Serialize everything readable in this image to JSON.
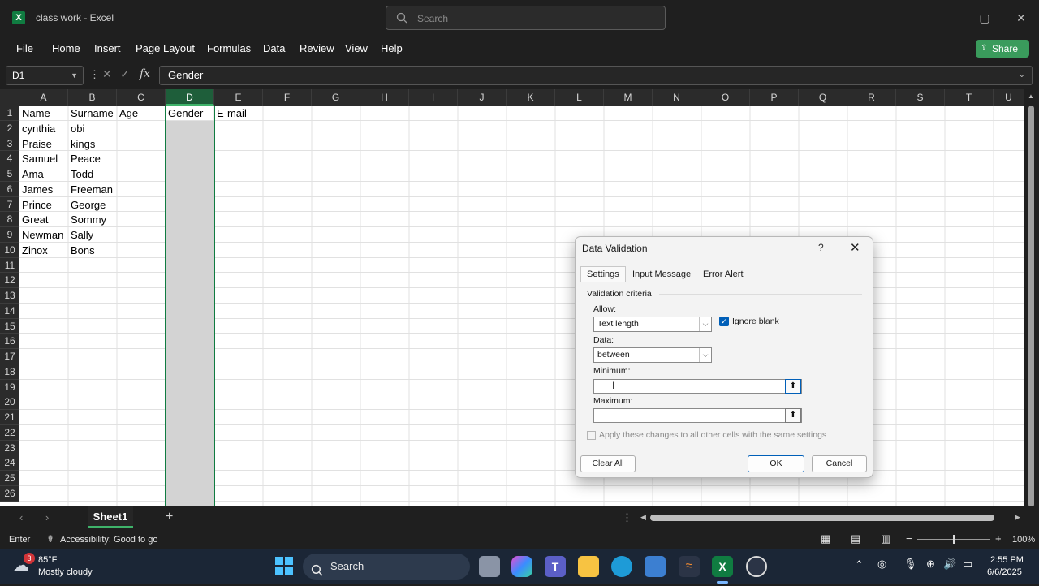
{
  "window": {
    "title": "class work - Excel",
    "search_placeholder": "Search",
    "minimize": "—",
    "maximize": "▢",
    "close": "✕"
  },
  "menu": [
    "File",
    "Home",
    "Insert",
    "Page Layout",
    "Formulas",
    "Data",
    "Review",
    "View",
    "Help"
  ],
  "share_label": "Share",
  "formula_bar": {
    "name_box": "D1",
    "fx": "fx",
    "value": "Gender"
  },
  "columns": [
    "A",
    "B",
    "C",
    "D",
    "E",
    "F",
    "G",
    "H",
    "I",
    "J",
    "K",
    "L",
    "M",
    "N",
    "O",
    "P",
    "Q",
    "R",
    "S",
    "T",
    "U"
  ],
  "rows": [
    "1",
    "2",
    "3",
    "4",
    "5",
    "6",
    "7",
    "8",
    "9",
    "10",
    "11",
    "12",
    "13",
    "14",
    "15",
    "16",
    "17",
    "18",
    "19",
    "20",
    "21",
    "22",
    "23",
    "24",
    "25",
    "26"
  ],
  "cells": {
    "A1": "Name",
    "B1": "Surname",
    "C1": "Age",
    "D1": "Gender",
    "E1": "E-mail",
    "A2": "cynthia",
    "B2": "obi",
    "A3": "Praise",
    "B3": "kings",
    "A4": "Samuel",
    "B4": "Peace",
    "A5": "Ama",
    "B5": "Todd",
    "A6": "James",
    "B6": "Freeman",
    "A7": "Prince",
    "B7": "George",
    "A8": "Great",
    "B8": "Sommy",
    "A9": "Newman",
    "B9": "Sally",
    "A10": "Zinox",
    "B10": "Bons"
  },
  "sheet_tab": "Sheet1",
  "status": {
    "mode": "Enter",
    "accessibility": "Accessibility: Good to go",
    "zoom": "100%"
  },
  "taskbar": {
    "weather_temp": "85°F",
    "weather_desc": "Mostly cloudy",
    "weather_badge": "3",
    "search_label": "Search",
    "time": "2:55 PM",
    "date": "6/6/2025"
  },
  "dialog": {
    "title": "Data Validation",
    "help": "?",
    "close": "✕",
    "tabs": [
      "Settings",
      "Input Message",
      "Error Alert"
    ],
    "section": "Validation criteria",
    "allow_label": "Allow:",
    "allow_value": "Text length",
    "ignore_blank_label": "Ignore blank",
    "ignore_blank_checked": true,
    "data_label": "Data:",
    "data_value": "between",
    "minimum_label": "Minimum:",
    "minimum_value": "",
    "maximum_label": "Maximum:",
    "maximum_value": "",
    "apply_label": "Apply these changes to all other cells with the same settings",
    "clear_all": "Clear All",
    "ok": "OK",
    "cancel": "Cancel"
  },
  "colors": {
    "excel_green": "#107c41",
    "selection_green": "#1e5e3a",
    "share_green": "#3a9b5c",
    "taskbar": "#1b2636"
  }
}
